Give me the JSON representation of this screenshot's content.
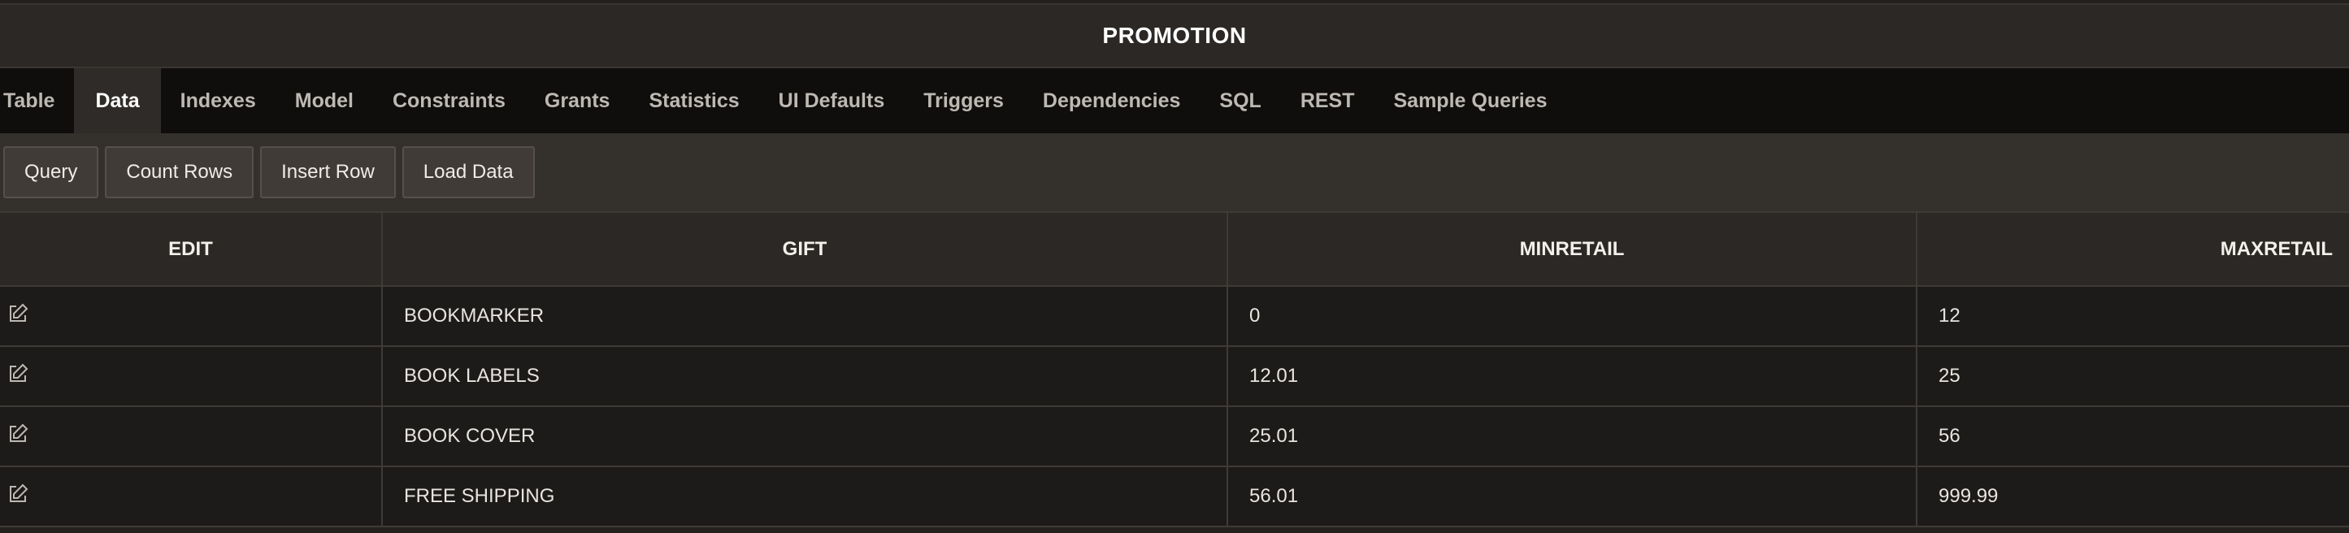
{
  "header": {
    "title": "PROMOTION"
  },
  "tabs": [
    {
      "label": "Table",
      "active": false
    },
    {
      "label": "Data",
      "active": true
    },
    {
      "label": "Indexes",
      "active": false
    },
    {
      "label": "Model",
      "active": false
    },
    {
      "label": "Constraints",
      "active": false
    },
    {
      "label": "Grants",
      "active": false
    },
    {
      "label": "Statistics",
      "active": false
    },
    {
      "label": "UI Defaults",
      "active": false
    },
    {
      "label": "Triggers",
      "active": false
    },
    {
      "label": "Dependencies",
      "active": false
    },
    {
      "label": "SQL",
      "active": false
    },
    {
      "label": "REST",
      "active": false
    },
    {
      "label": "Sample Queries",
      "active": false
    }
  ],
  "toolbar": {
    "query_label": "Query",
    "count_rows_label": "Count Rows",
    "insert_row_label": "Insert Row",
    "load_data_label": "Load Data"
  },
  "grid": {
    "columns": [
      "EDIT",
      "GIFT",
      "MINRETAIL",
      "MAXRETAIL"
    ],
    "rows": [
      {
        "gift": "BOOKMARKER",
        "minretail": "0",
        "maxretail": "12"
      },
      {
        "gift": "BOOK LABELS",
        "minretail": "12.01",
        "maxretail": "25"
      },
      {
        "gift": "BOOK COVER",
        "minretail": "25.01",
        "maxretail": "56"
      },
      {
        "gift": "FREE SHIPPING",
        "minretail": "56.01",
        "maxretail": "999.99"
      }
    ],
    "edit_icon": "edit-icon"
  },
  "colors": {
    "background": "#23201e",
    "tab_bar": "#0f0e0d",
    "toolbar": "#34302c",
    "row": "#1d1b19"
  }
}
